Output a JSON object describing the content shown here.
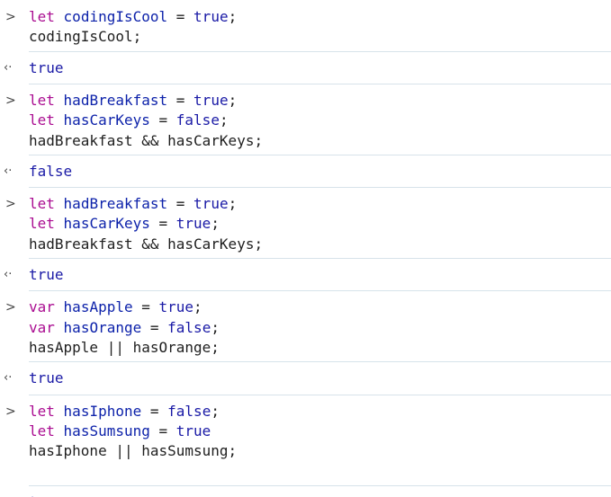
{
  "prompt_in": ">",
  "prompt_out": "‹·",
  "entries": [
    {
      "input": [
        [
          [
            "kw",
            "let"
          ],
          [
            "plain",
            " "
          ],
          [
            "var",
            "codingIsCool"
          ],
          [
            "plain",
            " = "
          ],
          [
            "val",
            "true"
          ],
          [
            "plain",
            ";"
          ]
        ],
        [
          [
            "plain",
            "codingIsCool;"
          ]
        ]
      ],
      "output": "true"
    },
    {
      "input": [
        [
          [
            "kw",
            "let"
          ],
          [
            "plain",
            " "
          ],
          [
            "var",
            "hadBreakfast"
          ],
          [
            "plain",
            " = "
          ],
          [
            "val",
            "true"
          ],
          [
            "plain",
            ";"
          ]
        ],
        [
          [
            "kw",
            "let"
          ],
          [
            "plain",
            " "
          ],
          [
            "var",
            "hasCarKeys"
          ],
          [
            "plain",
            " = "
          ],
          [
            "val",
            "false"
          ],
          [
            "plain",
            ";"
          ]
        ],
        [
          [
            "plain",
            "hadBreakfast && hasCarKeys;"
          ]
        ]
      ],
      "output": "false"
    },
    {
      "input": [
        [
          [
            "kw",
            "let"
          ],
          [
            "plain",
            " "
          ],
          [
            "var",
            "hadBreakfast"
          ],
          [
            "plain",
            " = "
          ],
          [
            "val",
            "true"
          ],
          [
            "plain",
            ";"
          ]
        ],
        [
          [
            "kw",
            "let"
          ],
          [
            "plain",
            " "
          ],
          [
            "var",
            "hasCarKeys"
          ],
          [
            "plain",
            " = "
          ],
          [
            "val",
            "true"
          ],
          [
            "plain",
            ";"
          ]
        ],
        [
          [
            "plain",
            "hadBreakfast && hasCarKeys;"
          ]
        ]
      ],
      "output": "true"
    },
    {
      "input": [
        [
          [
            "kw",
            "var"
          ],
          [
            "plain",
            " "
          ],
          [
            "var",
            "hasApple"
          ],
          [
            "plain",
            " = "
          ],
          [
            "val",
            "true"
          ],
          [
            "plain",
            ";"
          ]
        ],
        [
          [
            "kw",
            "var"
          ],
          [
            "plain",
            " "
          ],
          [
            "var",
            "hasOrange"
          ],
          [
            "plain",
            " = "
          ],
          [
            "val",
            "false"
          ],
          [
            "plain",
            ";"
          ]
        ],
        [
          [
            "plain",
            "hasApple || hasOrange;"
          ]
        ]
      ],
      "output": "true"
    },
    {
      "input": [
        [
          [
            "kw",
            "let"
          ],
          [
            "plain",
            " "
          ],
          [
            "var",
            "hasIphone"
          ],
          [
            "plain",
            " = "
          ],
          [
            "val",
            "false"
          ],
          [
            "plain",
            ";"
          ]
        ],
        [
          [
            "kw",
            "let"
          ],
          [
            "plain",
            " "
          ],
          [
            "var",
            "hasSumsung"
          ],
          [
            "plain",
            " = "
          ],
          [
            "val",
            "true"
          ]
        ],
        [
          [
            "plain",
            "hasIphone || hasSumsung;"
          ]
        ],
        [
          [
            "plain",
            ""
          ]
        ]
      ],
      "output": "true"
    }
  ],
  "colors": {
    "keyword": "#aa0d91",
    "variable": "#0d22aa",
    "value": "#1a1aa6",
    "text": "#1f1f1f",
    "divider": "#d7e3ea"
  }
}
